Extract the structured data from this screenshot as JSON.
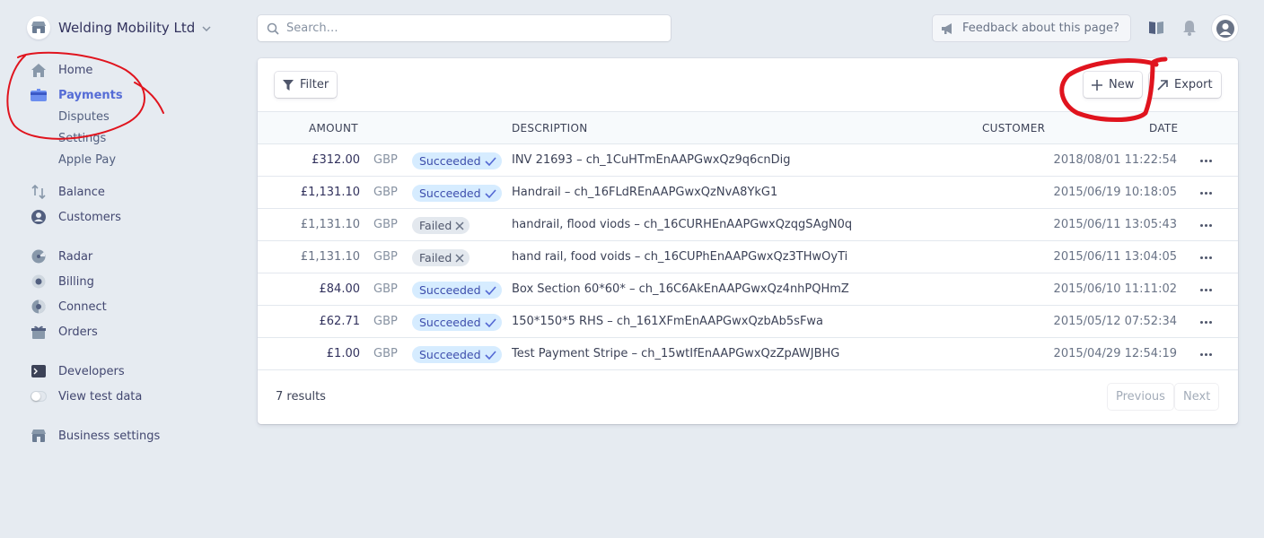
{
  "account": {
    "name": "Welding Mobility Ltd"
  },
  "search": {
    "placeholder": "Search…"
  },
  "feedback": {
    "label": "Feedback about this page?"
  },
  "nav": {
    "home": "Home",
    "payments": "Payments",
    "payments_sub": [
      "Disputes",
      "Settings",
      "Apple Pay"
    ],
    "balance": "Balance",
    "customers": "Customers",
    "radar": "Radar",
    "billing": "Billing",
    "connect": "Connect",
    "orders": "Orders",
    "developers": "Developers",
    "test_data": "View test data",
    "business_settings": "Business settings"
  },
  "toolbar": {
    "filter": "Filter",
    "new": "New",
    "export": "Export"
  },
  "table": {
    "headers": {
      "amount": "AMOUNT",
      "description": "DESCRIPTION",
      "customer": "CUSTOMER",
      "date": "DATE"
    },
    "rows": [
      {
        "amount": "£312.00",
        "currency": "GBP",
        "status": "Succeeded",
        "description": "INV 21693 – ch_1CuHTmEnAAPGwxQz9q6cnDig",
        "date": "2018/08/01 11:22:54"
      },
      {
        "amount": "£1,131.10",
        "currency": "GBP",
        "status": "Succeeded",
        "description": "Handrail – ch_16FLdREnAAPGwxQzNvA8YkG1",
        "date": "2015/06/19 10:18:05"
      },
      {
        "amount": "£1,131.10",
        "currency": "GBP",
        "status": "Failed",
        "description": "handrail, flood viods – ch_16CURHEnAAPGwxQzqgSAgN0q",
        "date": "2015/06/11 13:05:43"
      },
      {
        "amount": "£1,131.10",
        "currency": "GBP",
        "status": "Failed",
        "description": "hand rail, food voids – ch_16CUPhEnAAPGwxQz3THwOyTi",
        "date": "2015/06/11 13:04:05"
      },
      {
        "amount": "£84.00",
        "currency": "GBP",
        "status": "Succeeded",
        "description": "Box Section 60*60* – ch_16C6AkEnAAPGwxQz4nhPQHmZ",
        "date": "2015/06/10 11:11:02"
      },
      {
        "amount": "£62.71",
        "currency": "GBP",
        "status": "Succeeded",
        "description": "150*150*5 RHS – ch_161XFmEnAAPGwxQzbAb5sFwa",
        "date": "2015/05/12 07:52:34"
      },
      {
        "amount": "£1.00",
        "currency": "GBP",
        "status": "Succeeded",
        "description": "Test Payment Stripe – ch_15wtIfEnAAPGwxQzZpAWJBHG",
        "date": "2015/04/29 12:54:19"
      }
    ]
  },
  "footer": {
    "results": "7 results",
    "previous": "Previous",
    "next": "Next"
  },
  "colors": {
    "accent": "#556cd6",
    "annotation": "#e0141e",
    "background": "#e6ebf1"
  }
}
